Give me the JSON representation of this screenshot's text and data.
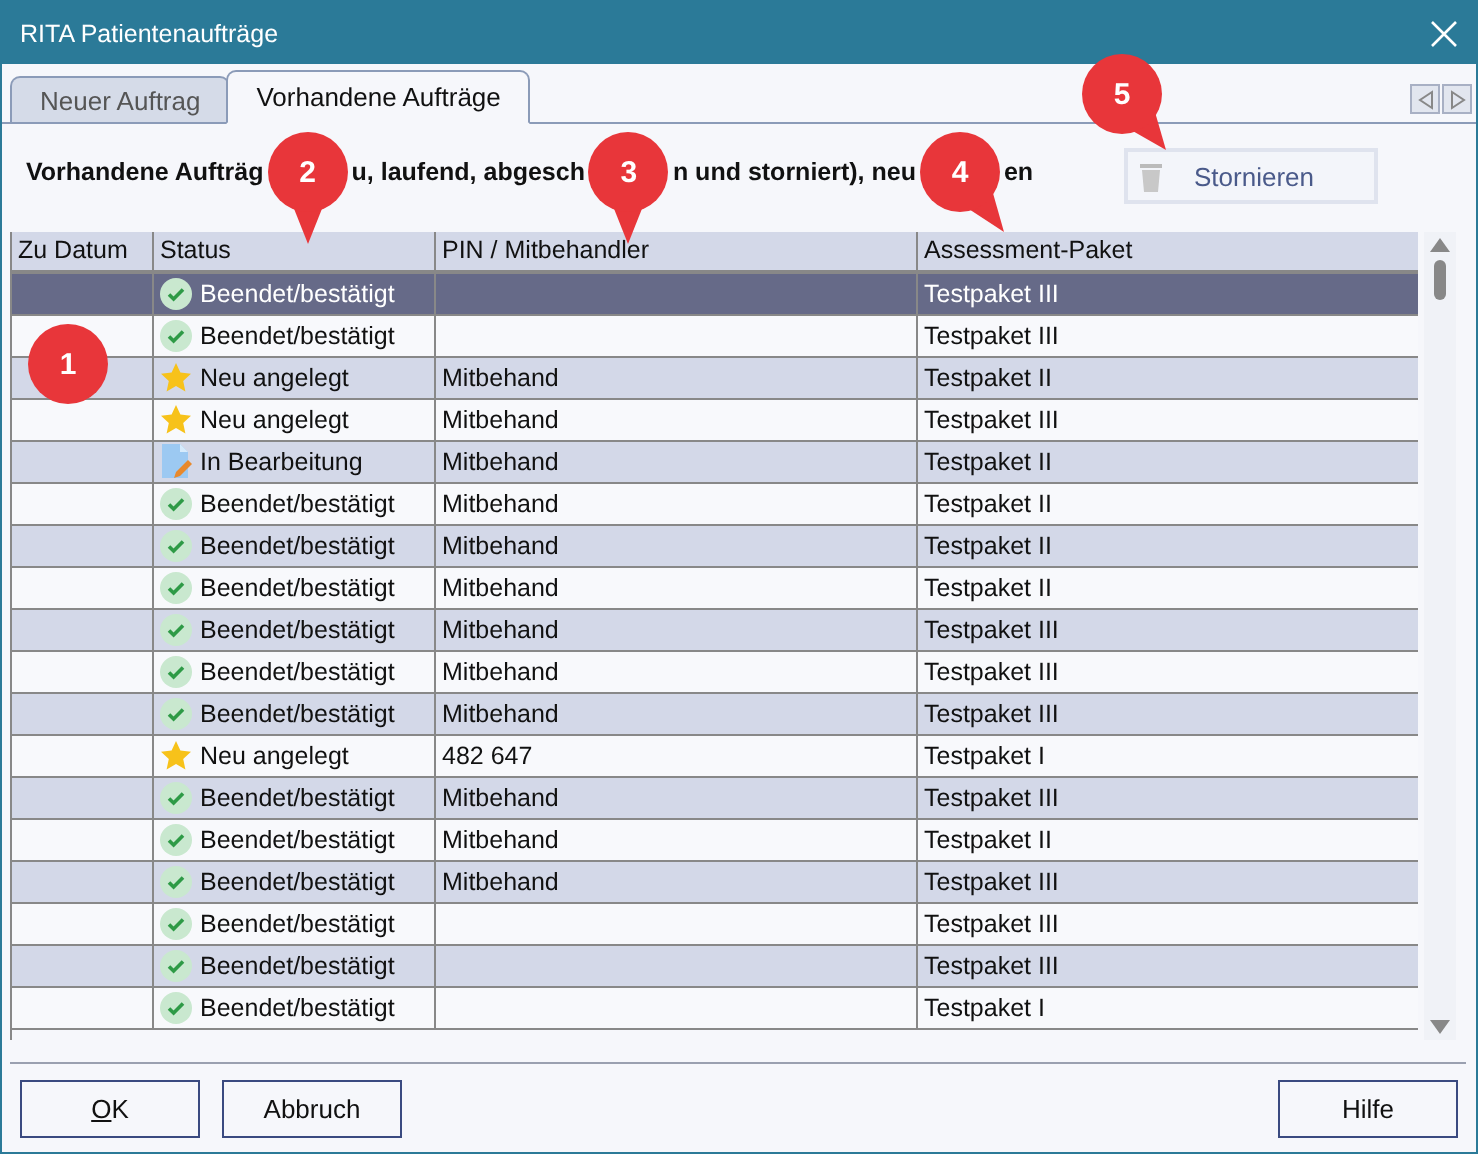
{
  "window": {
    "title": "RITA Patientenaufträge"
  },
  "tabs": [
    {
      "label": "Neuer Auftrag",
      "selected": false
    },
    {
      "label": "Vorhandene Aufträge",
      "selected": true
    }
  ],
  "description": [
    "Vorhandene Aufträg",
    "u, laufend, abgesch",
    "n und storniert), neu",
    "en"
  ],
  "cancel_button": {
    "label": "Stornieren",
    "disabled": true
  },
  "table": {
    "columns": [
      "Zu Datum",
      "Status",
      "PIN / Mitbehandler",
      "Assessment-Paket"
    ],
    "rows": [
      {
        "kind": "done",
        "status": "Beendet/bestätigt",
        "pin": "",
        "package": "Testpaket III",
        "selected": true
      },
      {
        "kind": "done",
        "status": "Beendet/bestätigt",
        "pin": "",
        "package": "Testpaket III",
        "selected": false
      },
      {
        "kind": "new",
        "status": "Neu angelegt",
        "pin": "Mitbehand",
        "package": "Testpaket II",
        "selected": false
      },
      {
        "kind": "new",
        "status": "Neu angelegt",
        "pin": "Mitbehand",
        "package": "Testpaket III",
        "selected": false
      },
      {
        "kind": "editing",
        "status": "In Bearbeitung",
        "pin": "Mitbehand",
        "package": "Testpaket II",
        "selected": false
      },
      {
        "kind": "done",
        "status": "Beendet/bestätigt",
        "pin": "Mitbehand",
        "package": "Testpaket II",
        "selected": false
      },
      {
        "kind": "done",
        "status": "Beendet/bestätigt",
        "pin": "Mitbehand",
        "package": "Testpaket II",
        "selected": false
      },
      {
        "kind": "done",
        "status": "Beendet/bestätigt",
        "pin": "Mitbehand",
        "package": "Testpaket II",
        "selected": false
      },
      {
        "kind": "done",
        "status": "Beendet/bestätigt",
        "pin": "Mitbehand",
        "package": "Testpaket III",
        "selected": false
      },
      {
        "kind": "done",
        "status": "Beendet/bestätigt",
        "pin": "Mitbehand",
        "package": "Testpaket III",
        "selected": false
      },
      {
        "kind": "done",
        "status": "Beendet/bestätigt",
        "pin": "Mitbehand",
        "package": "Testpaket III",
        "selected": false
      },
      {
        "kind": "new",
        "status": "Neu angelegt",
        "pin": "482 647",
        "package": "Testpaket I",
        "selected": false
      },
      {
        "kind": "done",
        "status": "Beendet/bestätigt",
        "pin": "Mitbehand",
        "package": "Testpaket III",
        "selected": false
      },
      {
        "kind": "done",
        "status": "Beendet/bestätigt",
        "pin": "Mitbehand",
        "package": "Testpaket II",
        "selected": false
      },
      {
        "kind": "done",
        "status": "Beendet/bestätigt",
        "pin": "Mitbehand",
        "package": "Testpaket III",
        "selected": false
      },
      {
        "kind": "done",
        "status": "Beendet/bestätigt",
        "pin": "",
        "package": "Testpaket III",
        "selected": false
      },
      {
        "kind": "done",
        "status": "Beendet/bestätigt",
        "pin": "",
        "package": "Testpaket III",
        "selected": false
      },
      {
        "kind": "done",
        "status": "Beendet/bestätigt",
        "pin": "",
        "package": "Testpaket I",
        "selected": false
      }
    ]
  },
  "callouts": [
    "1",
    "2",
    "3",
    "4",
    "5"
  ],
  "buttons": [
    {
      "mnemonic": "O",
      "rest": "K"
    },
    {
      "rest": "Abbruch"
    },
    {
      "rest": "Hilfe"
    }
  ]
}
